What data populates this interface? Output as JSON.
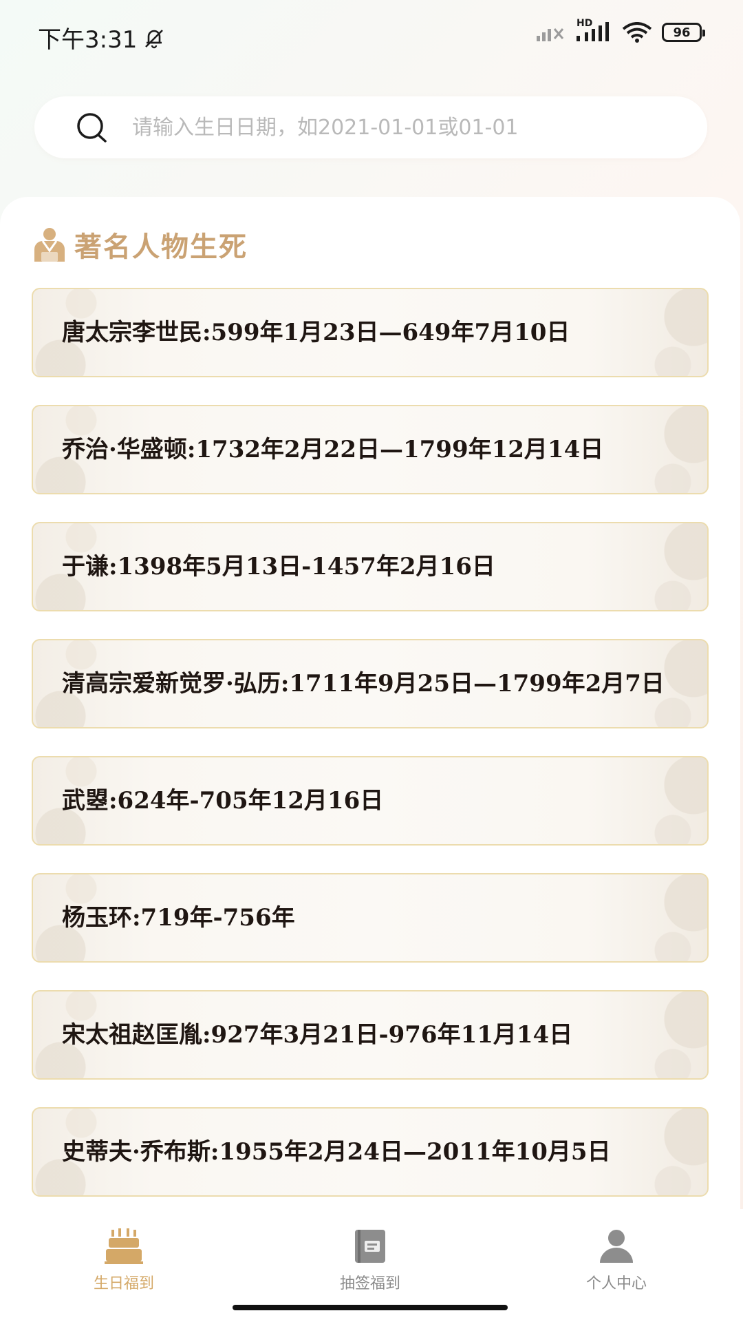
{
  "status_bar": {
    "time": "下午3:31",
    "network_label": "HD",
    "battery": "96"
  },
  "search": {
    "placeholder": "请输入生日日期，如2021-01-01或01-01",
    "value": ""
  },
  "section": {
    "title": "著名人物生死"
  },
  "items": [
    "唐太宗李世民:599年1月23日—649年7月10日",
    "乔治·华盛顿:1732年2月22日—1799年12月14日",
    "于谦:1398年5月13日-1457年2月16日",
    "清高宗爱新觉罗·弘历:1711年9月25日—1799年2月7日",
    "武曌:624年-705年12月16日",
    "杨玉环:719年-756年",
    "宋太祖赵匡胤:927年3月21日-976年11月14日",
    "史蒂夫·乔布斯:1955年2月24日—2011年10月5日"
  ],
  "tabs": [
    {
      "label": "生日福到",
      "icon": "birthday-cake-icon",
      "active": true
    },
    {
      "label": "抽签福到",
      "icon": "lottery-book-icon",
      "active": false
    },
    {
      "label": "个人中心",
      "icon": "user-icon",
      "active": false
    }
  ],
  "colors": {
    "accent": "#d4a867",
    "title_gold": "#caa273",
    "card_border": "#ecdcae"
  }
}
